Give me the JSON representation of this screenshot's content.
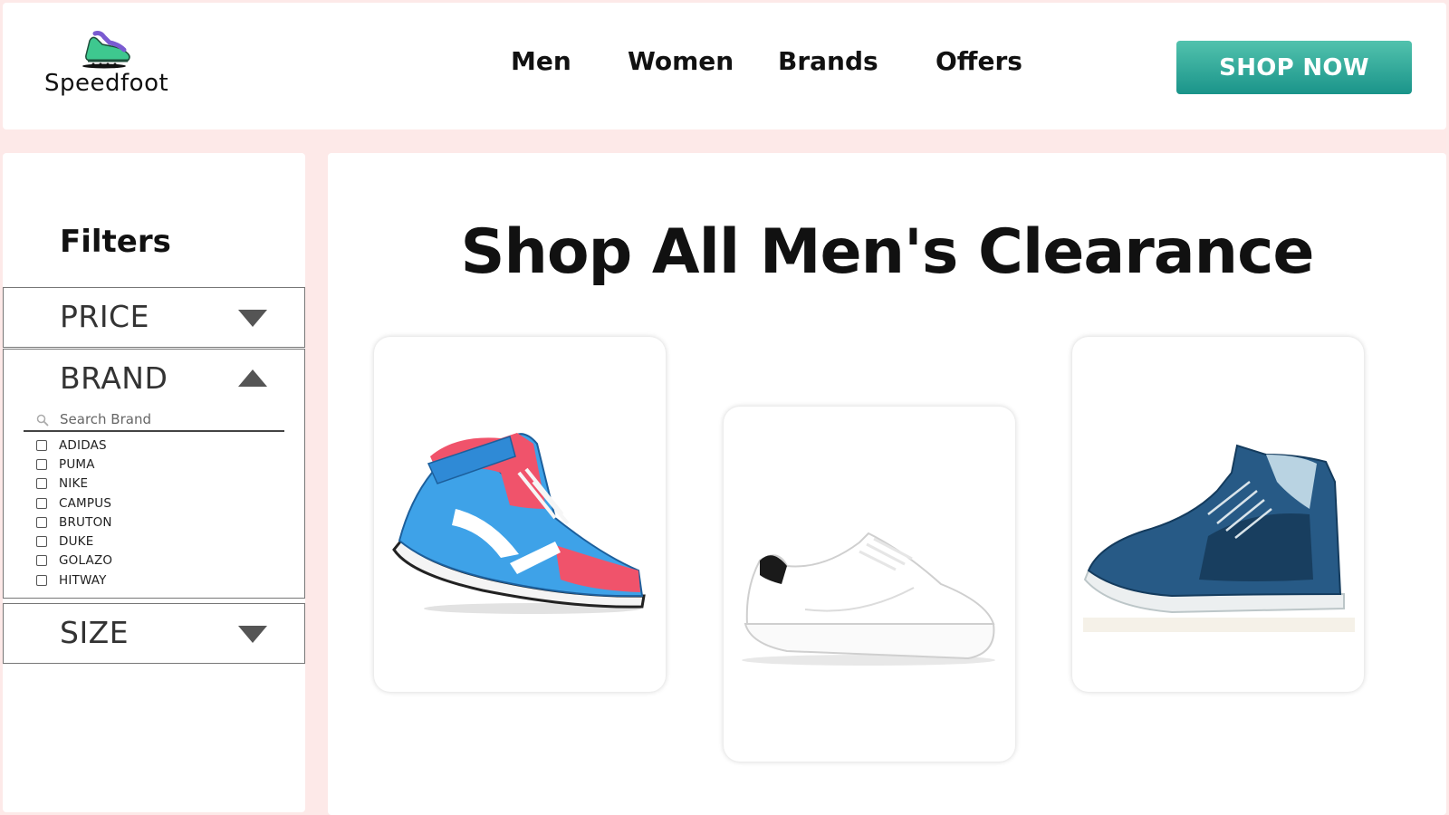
{
  "brand": {
    "name": "Speedfoot",
    "icon": "sneaker-logo-icon"
  },
  "nav": {
    "links": [
      "Men",
      "Women",
      "Brands",
      "Offers"
    ],
    "cta_label": "SHOP NOW"
  },
  "sidebar": {
    "title": "Filters",
    "filters": {
      "price": {
        "label": "PRICE",
        "state": "collapsed",
        "icon": "chevron-down-icon"
      },
      "brand": {
        "label": "BRAND",
        "state": "expanded",
        "icon": "chevron-up-icon",
        "search_placeholder": "Search Brand",
        "options": [
          "ADIDAS",
          "PUMA",
          "NIKE",
          "CAMPUS",
          "BRUTON",
          "DUKE",
          "GOLAZO",
          "HITWAY"
        ]
      },
      "size": {
        "label": "SIZE",
        "state": "collapsed",
        "icon": "chevron-down-icon"
      }
    }
  },
  "main": {
    "title": "Shop All Men's Clearance",
    "products": [
      {
        "image": "blue-red-high-top-sneaker"
      },
      {
        "image": "white-low-top-sneaker"
      },
      {
        "image": "navy-high-top-sneaker"
      }
    ]
  },
  "colors": {
    "page_background": "#fde9e8",
    "cta_gradient_top": "#52c2ad",
    "cta_gradient_bottom": "#1a948a",
    "text": "#111111"
  }
}
